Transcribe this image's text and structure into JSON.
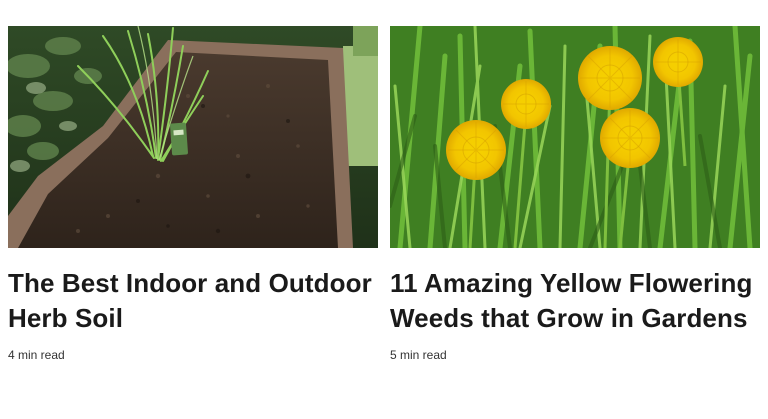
{
  "articles": [
    {
      "title": "The Best Indoor and Outdoor Herb Soil",
      "read_time": "4 min read",
      "image_subject": "soil-planter-image"
    },
    {
      "title": "11 Amazing Yellow Flowering Weeds that Grow in Gardens",
      "read_time": "5 min read",
      "image_subject": "dandelion-image"
    }
  ],
  "colors": {
    "title": "#1a1a1a",
    "meta": "#333333",
    "soil": "#3b2e24",
    "planter": "#8a6f5c",
    "grass": "#4e9a2c",
    "dandelion": "#f2c500"
  }
}
